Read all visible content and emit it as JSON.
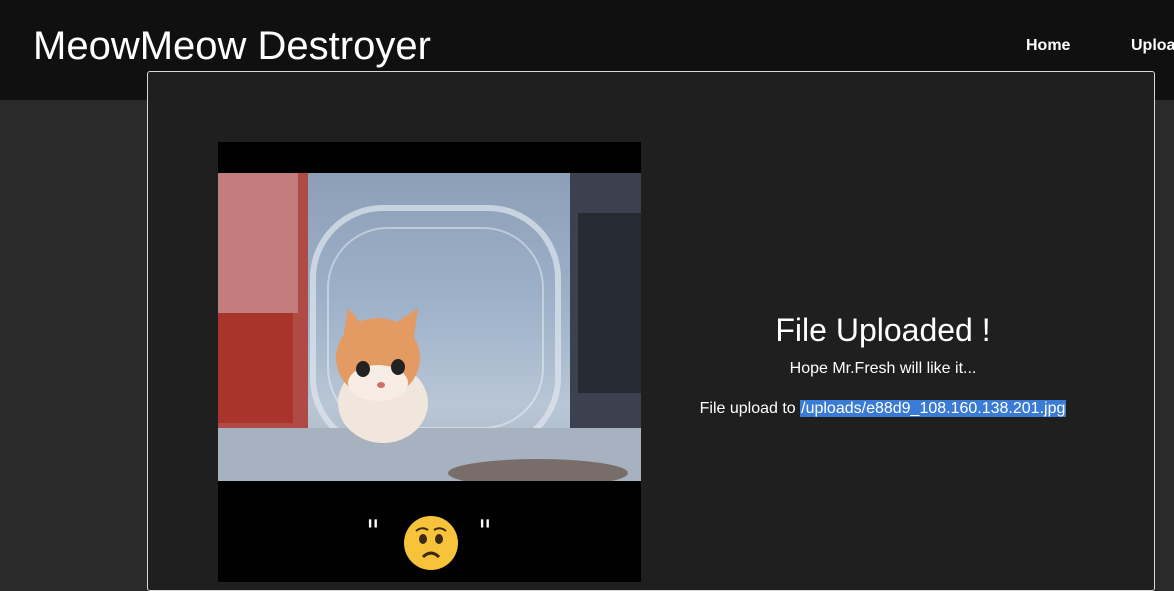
{
  "header": {
    "brand": "MeowMeow Destroyer",
    "nav": [
      {
        "label": "Home"
      },
      {
        "label": "Upload"
      }
    ]
  },
  "result": {
    "title": "File Uploaded !",
    "message": "Hope Mr.Fresh will like it...",
    "path_prefix": "File upload to",
    "path": "/uploads/e88d9_108.160.138.201.jpg"
  },
  "image": {
    "caption_quotes": [
      "\"",
      "\""
    ],
    "emoji": "worried-face"
  },
  "colors": {
    "header_bg": "#101010",
    "page_bg": "#2a2a2a",
    "card_bg": "#1f1f1f",
    "selection": "#3a7bd5"
  }
}
